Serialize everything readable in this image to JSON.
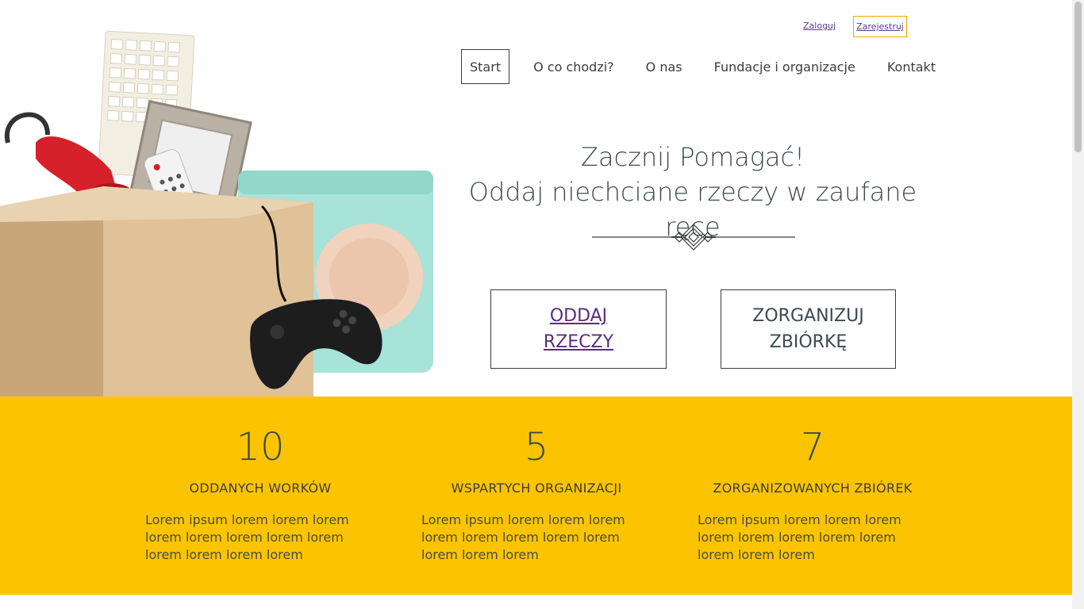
{
  "header": {
    "login_label": "Zaloguj",
    "register_label": "Zarejestruj"
  },
  "nav": {
    "items": [
      {
        "label": "Start",
        "active": true
      },
      {
        "label": "O co chodzi?"
      },
      {
        "label": "O nas"
      },
      {
        "label": "Fundacje i organizacje"
      },
      {
        "label": "Kontakt"
      }
    ]
  },
  "hero": {
    "headline_line1": "Zacznij Pomagać!",
    "headline_line2": "Oddaj niechciane rzeczy w zaufane ręce",
    "cta_give_line1": "ODDAJ",
    "cta_give_line2": "RZECZY",
    "cta_organize_line1": "ZORGANIZUJ",
    "cta_organize_line2": "ZBIÓRKĘ"
  },
  "stats": [
    {
      "number": "10",
      "title": "ODDANYCH WORKÓW",
      "desc": "Lorem ipsum lorem lorem lorem lorem lorem lorem lorem lorem lorem lorem lorem lorem"
    },
    {
      "number": "5",
      "title": "WSPARTYCH ORGANIZACJI",
      "desc": "Lorem ipsum lorem lorem lorem lorem lorem lorem lorem lorem lorem lorem lorem"
    },
    {
      "number": "7",
      "title": "ZORGANIZOWANYCH ZBIÓREK",
      "desc": "Lorem ipsum lorem lorem lorem lorem lorem lorem lorem lorem lorem lorem lorem"
    }
  ],
  "colors": {
    "accent_yellow": "#fcc400",
    "text_dark": "#3c4a4f",
    "link_purple": "#5b2b7a",
    "register_border": "#f0a500"
  }
}
